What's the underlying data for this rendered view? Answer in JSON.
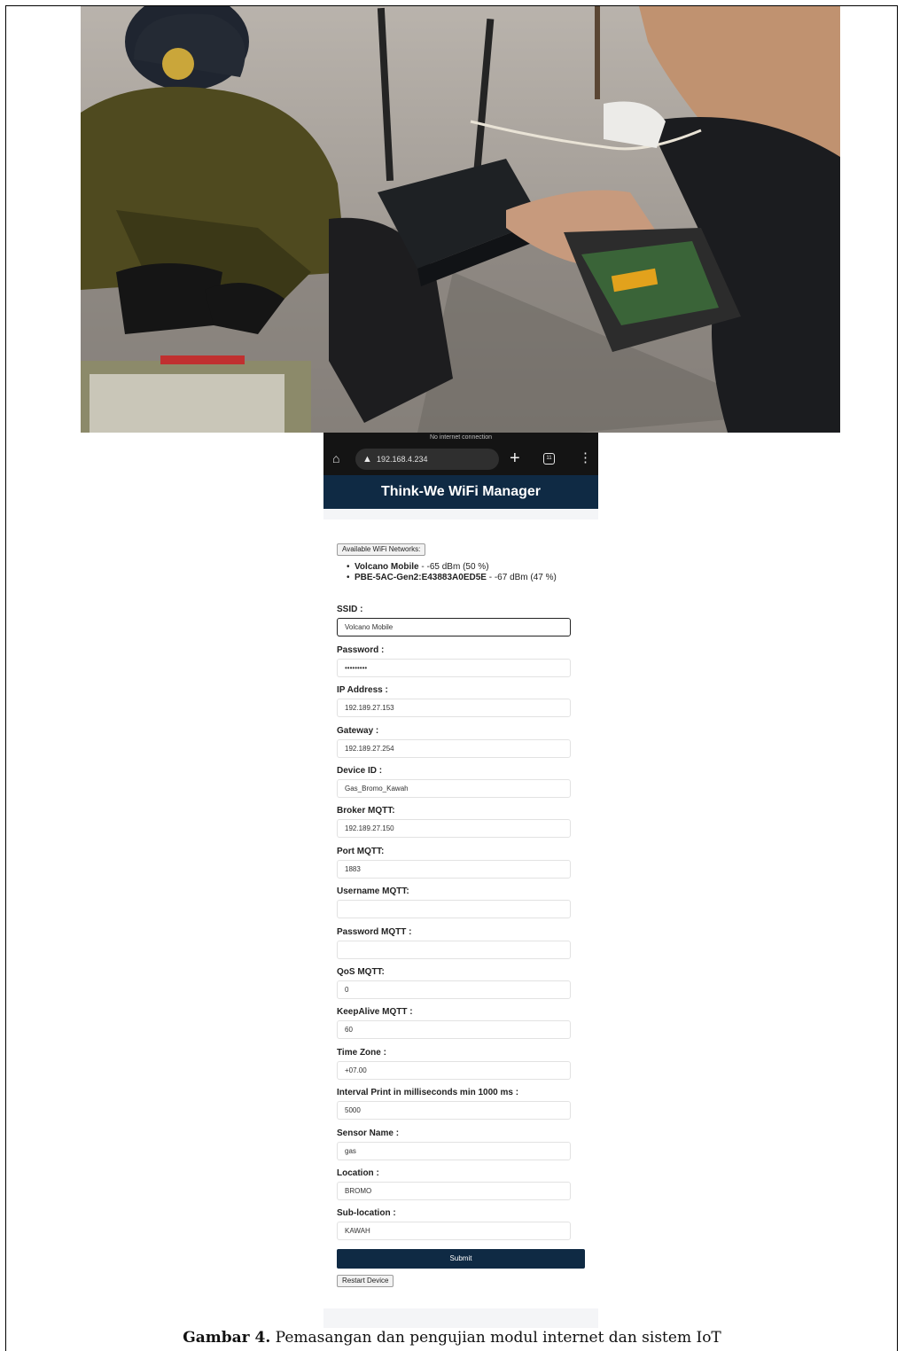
{
  "browser": {
    "status_text": "No internet connection",
    "url": "192.168.4.234",
    "tab_count": "11"
  },
  "app": {
    "title": "Think-We WiFi Manager"
  },
  "networks": {
    "button_label": "Available WiFi Networks:",
    "items": [
      {
        "name": "Volcano Mobile",
        "detail": " - -65 dBm (50 %)"
      },
      {
        "name": "PBE-5AC-Gen2:E43883A0ED5E",
        "detail": " - -67 dBm (47 %)"
      }
    ]
  },
  "form": {
    "fields": [
      {
        "label": "SSID :",
        "value": "Volcano Mobile"
      },
      {
        "label": "Password :",
        "value": "•••••••••"
      },
      {
        "label": "IP Address :",
        "value": "192.189.27.153"
      },
      {
        "label": "Gateway :",
        "value": "192.189.27.254"
      },
      {
        "label": "Device ID :",
        "value": "Gas_Bromo_Kawah"
      },
      {
        "label": "Broker MQTT:",
        "value": "192.189.27.150"
      },
      {
        "label": "Port MQTT:",
        "value": "1883"
      },
      {
        "label": "Username MQTT:",
        "value": ""
      },
      {
        "label": "Password MQTT :",
        "value": ""
      },
      {
        "label": "QoS MQTT:",
        "value": "0"
      },
      {
        "label": "KeepAlive MQTT :",
        "value": "60"
      },
      {
        "label": "Time Zone :",
        "value": "+07.00"
      },
      {
        "label": "Interval Print in milliseconds min 1000 ms :",
        "value": "5000"
      },
      {
        "label": "Sensor Name :",
        "value": "gas"
      },
      {
        "label": "Location :",
        "value": "BROMO"
      },
      {
        "label": "Sub-location :",
        "value": "KAWAH"
      }
    ],
    "submit_label": "Submit",
    "restart_label": "Restart Device"
  },
  "caption": {
    "prefix": "Gambar 4.",
    "text": " Pemasangan dan pengujian modul internet dan sistem IoT"
  },
  "icons": [
    "home-icon",
    "warning-icon",
    "plus-icon",
    "tabs-icon",
    "menu-icon"
  ]
}
